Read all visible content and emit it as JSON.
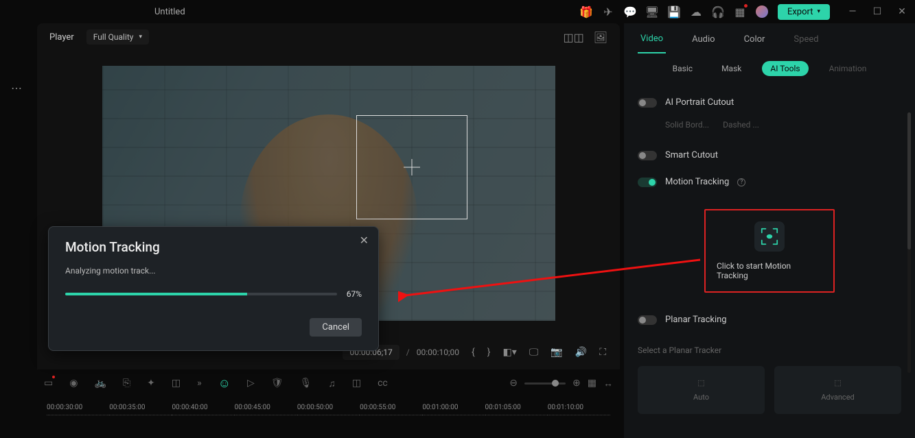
{
  "titlebar": {
    "project_name": "Untitled",
    "export_label": "Export"
  },
  "player": {
    "label": "Player",
    "quality": "Full Quality",
    "current_time": "00:00:06;17",
    "total_time": "00:00:10;00"
  },
  "modal": {
    "title": "Motion Tracking",
    "status": "Analyzing motion track...",
    "percent": "67%",
    "cancel_label": "Cancel"
  },
  "timeline": {
    "marks": [
      "00:00:30:00",
      "00:00:35:00",
      "00:00:40:00",
      "00:00:45:00",
      "00:00:50:00",
      "00:00:55:00",
      "00:01:00:00",
      "00:01:05:00",
      "00:01:10:00"
    ]
  },
  "right_panel": {
    "tabs": {
      "video": "Video",
      "audio": "Audio",
      "color": "Color",
      "speed": "Speed"
    },
    "subtabs": {
      "basic": "Basic",
      "mask": "Mask",
      "ai": "AI Tools",
      "animation": "Animation"
    },
    "ai_portrait": "AI Portrait Cutout",
    "ai_portrait_opt1": "Solid Bord...",
    "ai_portrait_opt2": "Dashed ...",
    "smart_cutout": "Smart Cutout",
    "motion_tracking": "Motion Tracking",
    "mt_start": "Click to start Motion Tracking",
    "planar_tracking": "Planar Tracking",
    "planar_select": "Select a Planar Tracker",
    "planar_auto": "Auto",
    "planar_advanced": "Advanced"
  }
}
